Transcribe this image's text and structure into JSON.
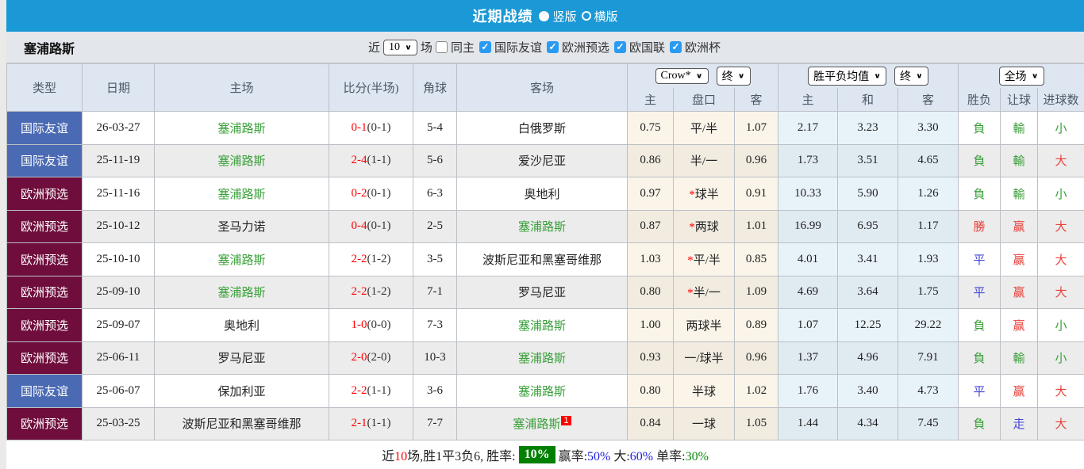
{
  "page": {
    "title": "近期战绩",
    "view_options": {
      "vertical": "竖版",
      "horizontal": "横版",
      "selected": "vertical"
    }
  },
  "filter": {
    "team": "塞浦路斯",
    "recent_label": "近",
    "recent_value": "10",
    "matches_label": "场",
    "same_home_label": "同主",
    "competitions": [
      "国际友谊",
      "欧洲预选",
      "欧国联",
      "欧洲杯"
    ]
  },
  "table": {
    "headers": [
      "类型",
      "日期",
      "主场",
      "比分(半场)",
      "角球",
      "客场"
    ],
    "dropdowns": {
      "odds_company": "Crow*",
      "odds_stage_1": "终",
      "avg_type": "胜平负均值",
      "odds_stage_2": "终",
      "scope": "全场"
    },
    "sub_headers": [
      "主",
      "盘口",
      "客",
      "主",
      "和",
      "客",
      "胜负",
      "让球",
      "进球数"
    ],
    "rows": [
      {
        "type": "国际友谊",
        "type_color": "blue",
        "date": "26-03-27",
        "home": "塞浦路斯",
        "home_highlight": true,
        "score": "0-1",
        "half": "0-1",
        "corner": "5-4",
        "away": "白俄罗斯",
        "away_highlight": false,
        "away_badge": "",
        "odds_home": "0.75",
        "handicap": "平/半",
        "handicap_star": false,
        "odds_away": "1.07",
        "avg_home": "2.17",
        "avg_draw": "3.23",
        "avg_away": "3.30",
        "result": {
          "text": "負",
          "color": "green"
        },
        "let": {
          "text": "輸",
          "color": "green"
        },
        "goals": {
          "text": "小",
          "color": "green"
        }
      },
      {
        "type": "国际友谊",
        "type_color": "blue",
        "date": "25-11-19",
        "home": "塞浦路斯",
        "home_highlight": true,
        "score": "2-4",
        "half": "1-1",
        "corner": "5-6",
        "away": "爱沙尼亚",
        "away_highlight": false,
        "away_badge": "",
        "odds_home": "0.86",
        "handicap": "半/一",
        "handicap_star": false,
        "odds_away": "0.96",
        "avg_home": "1.73",
        "avg_draw": "3.51",
        "avg_away": "4.65",
        "result": {
          "text": "負",
          "color": "green"
        },
        "let": {
          "text": "輸",
          "color": "green"
        },
        "goals": {
          "text": "大",
          "color": "red"
        }
      },
      {
        "type": "欧洲预选",
        "type_color": "maroon",
        "date": "25-11-16",
        "home": "塞浦路斯",
        "home_highlight": true,
        "score": "0-2",
        "half": "0-1",
        "corner": "6-3",
        "away": "奥地利",
        "away_highlight": false,
        "away_badge": "",
        "odds_home": "0.97",
        "handicap": "球半",
        "handicap_star": true,
        "odds_away": "0.91",
        "avg_home": "10.33",
        "avg_draw": "5.90",
        "avg_away": "1.26",
        "result": {
          "text": "負",
          "color": "green"
        },
        "let": {
          "text": "輸",
          "color": "green"
        },
        "goals": {
          "text": "小",
          "color": "green"
        }
      },
      {
        "type": "欧洲预选",
        "type_color": "maroon",
        "date": "25-10-12",
        "home": "圣马力诺",
        "home_highlight": false,
        "score": "0-4",
        "half": "0-1",
        "corner": "2-5",
        "away": "塞浦路斯",
        "away_highlight": true,
        "away_badge": "",
        "odds_home": "0.87",
        "handicap": "两球",
        "handicap_star": true,
        "odds_away": "1.01",
        "avg_home": "16.99",
        "avg_draw": "6.95",
        "avg_away": "1.17",
        "result": {
          "text": "勝",
          "color": "red"
        },
        "let": {
          "text": "赢",
          "color": "red"
        },
        "goals": {
          "text": "大",
          "color": "red"
        }
      },
      {
        "type": "欧洲预选",
        "type_color": "maroon",
        "date": "25-10-10",
        "home": "塞浦路斯",
        "home_highlight": true,
        "score": "2-2",
        "half": "1-2",
        "corner": "3-5",
        "away": "波斯尼亚和黑塞哥维那",
        "away_highlight": false,
        "away_badge": "",
        "odds_home": "1.03",
        "handicap": "平/半",
        "handicap_star": true,
        "odds_away": "0.85",
        "avg_home": "4.01",
        "avg_draw": "3.41",
        "avg_away": "1.93",
        "result": {
          "text": "平",
          "color": "blue"
        },
        "let": {
          "text": "赢",
          "color": "red"
        },
        "goals": {
          "text": "大",
          "color": "red"
        }
      },
      {
        "type": "欧洲预选",
        "type_color": "maroon",
        "date": "25-09-10",
        "home": "塞浦路斯",
        "home_highlight": true,
        "score": "2-2",
        "half": "1-2",
        "corner": "7-1",
        "away": "罗马尼亚",
        "away_highlight": false,
        "away_badge": "",
        "odds_home": "0.80",
        "handicap": "半/一",
        "handicap_star": true,
        "odds_away": "1.09",
        "avg_home": "4.69",
        "avg_draw": "3.64",
        "avg_away": "1.75",
        "result": {
          "text": "平",
          "color": "blue"
        },
        "let": {
          "text": "赢",
          "color": "red"
        },
        "goals": {
          "text": "大",
          "color": "red"
        }
      },
      {
        "type": "欧洲预选",
        "type_color": "maroon",
        "date": "25-09-07",
        "home": "奥地利",
        "home_highlight": false,
        "score": "1-0",
        "half": "0-0",
        "corner": "7-3",
        "away": "塞浦路斯",
        "away_highlight": true,
        "away_badge": "",
        "odds_home": "1.00",
        "handicap": "两球半",
        "handicap_star": false,
        "odds_away": "0.89",
        "avg_home": "1.07",
        "avg_draw": "12.25",
        "avg_away": "29.22",
        "result": {
          "text": "負",
          "color": "green"
        },
        "let": {
          "text": "赢",
          "color": "red"
        },
        "goals": {
          "text": "小",
          "color": "green"
        }
      },
      {
        "type": "欧洲预选",
        "type_color": "maroon",
        "date": "25-06-11",
        "home": "罗马尼亚",
        "home_highlight": false,
        "score": "2-0",
        "half": "2-0",
        "corner": "10-3",
        "away": "塞浦路斯",
        "away_highlight": true,
        "away_badge": "",
        "odds_home": "0.93",
        "handicap": "一/球半",
        "handicap_star": false,
        "odds_away": "0.96",
        "avg_home": "1.37",
        "avg_draw": "4.96",
        "avg_away": "7.91",
        "result": {
          "text": "負",
          "color": "green"
        },
        "let": {
          "text": "輸",
          "color": "green"
        },
        "goals": {
          "text": "小",
          "color": "green"
        }
      },
      {
        "type": "国际友谊",
        "type_color": "blue",
        "date": "25-06-07",
        "home": "保加利亚",
        "home_highlight": false,
        "score": "2-2",
        "half": "1-1",
        "corner": "3-6",
        "away": "塞浦路斯",
        "away_highlight": true,
        "away_badge": "",
        "odds_home": "0.80",
        "handicap": "半球",
        "handicap_star": false,
        "odds_away": "1.02",
        "avg_home": "1.76",
        "avg_draw": "3.40",
        "avg_away": "4.73",
        "result": {
          "text": "平",
          "color": "blue"
        },
        "let": {
          "text": "赢",
          "color": "red"
        },
        "goals": {
          "text": "大",
          "color": "red"
        }
      },
      {
        "type": "欧洲预选",
        "type_color": "maroon",
        "date": "25-03-25",
        "home": "波斯尼亚和黑塞哥维那",
        "home_highlight": false,
        "score": "2-1",
        "half": "1-1",
        "corner": "7-7",
        "away": "塞浦路斯",
        "away_highlight": true,
        "away_badge": "1",
        "odds_home": "0.84",
        "handicap": "一球",
        "handicap_star": false,
        "odds_away": "1.05",
        "avg_home": "1.44",
        "avg_draw": "4.34",
        "avg_away": "7.45",
        "result": {
          "text": "負",
          "color": "green"
        },
        "let": {
          "text": "走",
          "color": "blue"
        },
        "goals": {
          "text": "大",
          "color": "red"
        }
      }
    ]
  },
  "footer": {
    "prefix": "近",
    "count": "10",
    "mid": "场,胜1平3负6, 胜率:",
    "win_rate": "10%",
    "seg2_label": "赢率:",
    "seg2_value": "50%",
    "seg3_label": "大:",
    "seg3_value": "60%",
    "seg4_label": "单率:",
    "seg4_value": "30%"
  },
  "colors": {
    "topbar": "#1a99d6",
    "badge_blue": "#4a6ab3",
    "badge_maroon": "#6f0e3c",
    "team_green": "#3aa03a",
    "score_red": "#fe0000",
    "result_blue": "#4545d8",
    "win_rate_bg": "#008000"
  }
}
